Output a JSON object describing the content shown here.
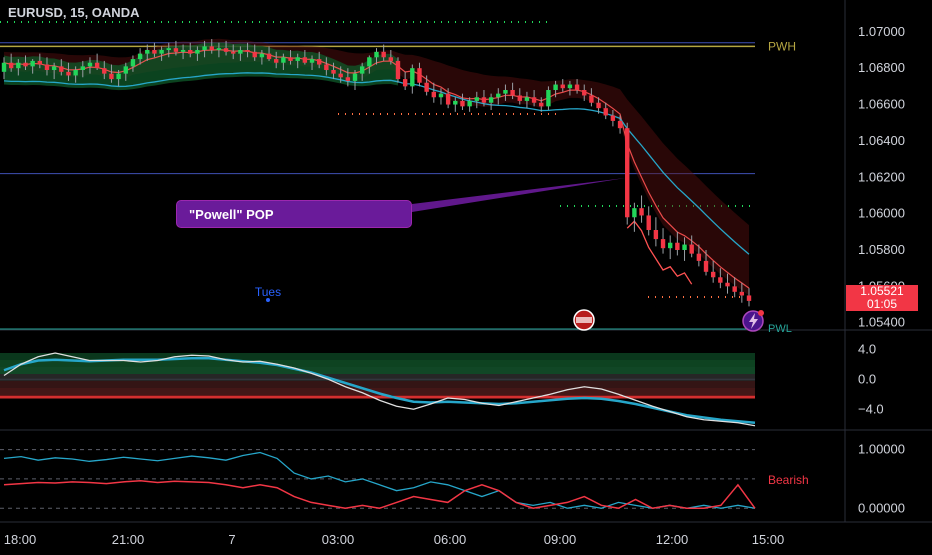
{
  "header": {
    "symbol_line": "EURUSD, 15, OANDA"
  },
  "price_tag": {
    "price": "1.05521",
    "countdown": "01:05"
  },
  "callout": {
    "text": "\"Powell\" POP"
  },
  "labels": {
    "pwh": "PWH",
    "pwl": "PWL",
    "tues": "Tues",
    "bearish": "Bearish"
  },
  "colors": {
    "bull": "#22d65a",
    "bear": "#f23645",
    "cyan": "#26a6c9",
    "olive": "#b5a642",
    "blue": "#3f51b5",
    "teal": "#26a69a",
    "purple": "#6a1b9a"
  },
  "chart_data": [
    {
      "type": "candlestick",
      "title": "EURUSD, 15, OANDA",
      "ylim": [
        1.0536,
        1.0712
      ],
      "y_ticks": [
        "1.07000",
        "1.06800",
        "1.06600",
        "1.06400",
        "1.06200",
        "1.06000",
        "1.05800",
        "1.05600",
        "1.05400"
      ],
      "x_ticks": [
        "18:00",
        "21:00",
        "7",
        "03:00",
        "06:00",
        "09:00",
        "12:00",
        "15:00"
      ],
      "levels": {
        "pwh": 1.0692,
        "pwl": 1.053,
        "line_top": 1.0694,
        "line_mid": 1.0622
      },
      "ohlc": [
        [
          1.0678,
          1.0686,
          1.0674,
          1.0683
        ],
        [
          1.0683,
          1.0688,
          1.0678,
          1.068
        ],
        [
          1.068,
          1.0685,
          1.0676,
          1.0683
        ],
        [
          1.0683,
          1.0687,
          1.0679,
          1.0681
        ],
        [
          1.0681,
          1.0685,
          1.0677,
          1.0684
        ],
        [
          1.0684,
          1.0688,
          1.068,
          1.0682
        ],
        [
          1.0682,
          1.0686,
          1.0676,
          1.0679
        ],
        [
          1.0679,
          1.0683,
          1.0674,
          1.0681
        ],
        [
          1.0681,
          1.0685,
          1.0676,
          1.0678
        ],
        [
          1.0678,
          1.0683,
          1.0673,
          1.0676
        ],
        [
          1.0676,
          1.0681,
          1.0672,
          1.0679
        ],
        [
          1.0679,
          1.0684,
          1.0675,
          1.0681
        ],
        [
          1.0681,
          1.0686,
          1.0677,
          1.0683
        ],
        [
          1.0683,
          1.0688,
          1.0679,
          1.068
        ],
        [
          1.068,
          1.0684,
          1.0674,
          1.0677
        ],
        [
          1.0677,
          1.0682,
          1.0672,
          1.0674
        ],
        [
          1.0674,
          1.0679,
          1.067,
          1.0677
        ],
        [
          1.0677,
          1.0683,
          1.0673,
          1.0681
        ],
        [
          1.0681,
          1.0687,
          1.0678,
          1.0685
        ],
        [
          1.0685,
          1.0691,
          1.0682,
          1.0688
        ],
        [
          1.0688,
          1.0693,
          1.0684,
          1.069
        ],
        [
          1.069,
          1.0694,
          1.0686,
          1.0688
        ],
        [
          1.0688,
          1.0692,
          1.0684,
          1.069
        ],
        [
          1.069,
          1.0694,
          1.0686,
          1.0691
        ],
        [
          1.0691,
          1.0695,
          1.0687,
          1.0689
        ],
        [
          1.0689,
          1.0693,
          1.0685,
          1.069
        ],
        [
          1.069,
          1.0694,
          1.0686,
          1.0688
        ],
        [
          1.0688,
          1.0692,
          1.0684,
          1.069
        ],
        [
          1.069,
          1.0695,
          1.0686,
          1.0692
        ],
        [
          1.0692,
          1.0696,
          1.0688,
          1.069
        ],
        [
          1.069,
          1.0694,
          1.0686,
          1.0691
        ],
        [
          1.0691,
          1.0695,
          1.0687,
          1.0689
        ],
        [
          1.0689,
          1.0693,
          1.0685,
          1.0688
        ],
        [
          1.0688,
          1.0692,
          1.0684,
          1.069
        ],
        [
          1.069,
          1.0694,
          1.0686,
          1.0689
        ],
        [
          1.0689,
          1.0693,
          1.0684,
          1.0686
        ],
        [
          1.0686,
          1.069,
          1.0682,
          1.0688
        ],
        [
          1.0688,
          1.0692,
          1.0684,
          1.0685
        ],
        [
          1.0685,
          1.0689,
          1.068,
          1.0683
        ],
        [
          1.0683,
          1.0688,
          1.0679,
          1.0686
        ],
        [
          1.0686,
          1.069,
          1.0682,
          1.0684
        ],
        [
          1.0684,
          1.0688,
          1.068,
          1.0686
        ],
        [
          1.0686,
          1.069,
          1.0682,
          1.0683
        ],
        [
          1.0683,
          1.0687,
          1.0679,
          1.0685
        ],
        [
          1.0685,
          1.0689,
          1.068,
          1.0682
        ],
        [
          1.0682,
          1.0686,
          1.0676,
          1.0679
        ],
        [
          1.0679,
          1.0683,
          1.0674,
          1.0677
        ],
        [
          1.0677,
          1.0681,
          1.0672,
          1.0675
        ],
        [
          1.0675,
          1.068,
          1.067,
          1.0673
        ],
        [
          1.0673,
          1.0679,
          1.0668,
          1.0677
        ],
        [
          1.0677,
          1.0683,
          1.0673,
          1.0681
        ],
        [
          1.0681,
          1.0687,
          1.0677,
          1.0686
        ],
        [
          1.0686,
          1.0691,
          1.0682,
          1.0689
        ],
        [
          1.0689,
          1.0693,
          1.0684,
          1.0686
        ],
        [
          1.0686,
          1.069,
          1.0682,
          1.0684
        ],
        [
          1.0684,
          1.0686,
          1.0672,
          1.0674
        ],
        [
          1.0674,
          1.0678,
          1.0668,
          1.067
        ],
        [
          1.067,
          1.0682,
          1.0666,
          1.068
        ],
        [
          1.068,
          1.0683,
          1.067,
          1.0672
        ],
        [
          1.0672,
          1.0676,
          1.0665,
          1.0667
        ],
        [
          1.0667,
          1.0672,
          1.0661,
          1.0664
        ],
        [
          1.0664,
          1.0669,
          1.066,
          1.0666
        ],
        [
          1.0666,
          1.0669,
          1.0658,
          1.066
        ],
        [
          1.066,
          1.0664,
          1.0656,
          1.0662
        ],
        [
          1.0662,
          1.0666,
          1.0657,
          1.0659
        ],
        [
          1.0659,
          1.0664,
          1.0656,
          1.0662
        ],
        [
          1.0662,
          1.0667,
          1.0658,
          1.0664
        ],
        [
          1.0664,
          1.0668,
          1.0659,
          1.0661
        ],
        [
          1.0661,
          1.0666,
          1.0657,
          1.0664
        ],
        [
          1.0664,
          1.0669,
          1.066,
          1.0666
        ],
        [
          1.0666,
          1.0671,
          1.0662,
          1.0668
        ],
        [
          1.0668,
          1.0672,
          1.0663,
          1.0665
        ],
        [
          1.0665,
          1.0669,
          1.066,
          1.0662
        ],
        [
          1.0662,
          1.0667,
          1.0658,
          1.0664
        ],
        [
          1.0664,
          1.0668,
          1.0659,
          1.0661
        ],
        [
          1.0661,
          1.0664,
          1.0656,
          1.0659
        ],
        [
          1.0659,
          1.067,
          1.0657,
          1.0668
        ],
        [
          1.0668,
          1.0673,
          1.0664,
          1.0671
        ],
        [
          1.0671,
          1.0674,
          1.0667,
          1.0669
        ],
        [
          1.0669,
          1.0673,
          1.0665,
          1.0671
        ],
        [
          1.0671,
          1.0674,
          1.0666,
          1.0668
        ],
        [
          1.0668,
          1.0671,
          1.0662,
          1.0665
        ],
        [
          1.0665,
          1.0669,
          1.0659,
          1.0661
        ],
        [
          1.0661,
          1.0664,
          1.0655,
          1.0658
        ],
        [
          1.0658,
          1.0661,
          1.0652,
          1.0654
        ],
        [
          1.0654,
          1.0657,
          1.0648,
          1.0651
        ],
        [
          1.0651,
          1.0654,
          1.0644,
          1.0647
        ],
        [
          1.0647,
          1.065,
          1.0594,
          1.0598
        ],
        [
          1.0598,
          1.0606,
          1.059,
          1.0603
        ],
        [
          1.0603,
          1.061,
          1.0595,
          1.0599
        ],
        [
          1.0599,
          1.0604,
          1.0588,
          1.0591
        ],
        [
          1.0591,
          1.0598,
          1.0582,
          1.0586
        ],
        [
          1.0586,
          1.0592,
          1.0578,
          1.0581
        ],
        [
          1.0581,
          1.0588,
          1.0575,
          1.0584
        ],
        [
          1.0584,
          1.059,
          1.0577,
          1.058
        ],
        [
          1.058,
          1.0587,
          1.0574,
          1.0583
        ],
        [
          1.0583,
          1.0588,
          1.0576,
          1.0578
        ],
        [
          1.0578,
          1.0583,
          1.0571,
          1.0574
        ],
        [
          1.0574,
          1.058,
          1.0566,
          1.0568
        ],
        [
          1.0568,
          1.0574,
          1.0562,
          1.0565
        ],
        [
          1.0565,
          1.057,
          1.0559,
          1.0562
        ],
        [
          1.0562,
          1.0567,
          1.0556,
          1.056
        ],
        [
          1.056,
          1.0565,
          1.0554,
          1.0557
        ],
        [
          1.0557,
          1.0562,
          1.0551,
          1.0555
        ],
        [
          1.0555,
          1.0559,
          1.0549,
          1.0552
        ]
      ]
    },
    {
      "type": "line",
      "title": "",
      "ylim": [
        -6.5,
        5.5
      ],
      "y_ticks": [
        "4.0",
        "0.0",
        "−4.0"
      ],
      "series": [
        {
          "name": "",
          "values": [
            0.5,
            2,
            3,
            3.5,
            3,
            2.5,
            2.5,
            2.5,
            2.3,
            2.5,
            3,
            3.2,
            3.1,
            2.6,
            2.3,
            2.4,
            2,
            1.5,
            0.8,
            0,
            -1,
            -1.8,
            -2.8,
            -3.6,
            -4,
            -3.3,
            -2.5,
            -2.7,
            -3.2,
            -3.5,
            -3,
            -2.5,
            -2,
            -1.4,
            -1,
            -1.3,
            -2,
            -2.8,
            -3.6,
            -4.3,
            -5,
            -5.4,
            -5.6,
            -5.8,
            -6.2
          ]
        },
        {
          "name": "",
          "values": [
            1.2,
            2,
            2.5,
            2.6,
            2.5,
            2.4,
            2.5,
            2.6,
            2.6,
            2.6,
            2.7,
            2.8,
            2.8,
            2.6,
            2.4,
            2.2,
            1.9,
            1.4,
            0.9,
            0.2,
            -0.5,
            -1.2,
            -1.9,
            -2.5,
            -3,
            -3.1,
            -3,
            -3.1,
            -3.2,
            -3.3,
            -3.2,
            -3,
            -2.8,
            -2.6,
            -2.5,
            -2.6,
            -2.9,
            -3.3,
            -3.8,
            -4.3,
            -4.8,
            -5.1,
            -5.4,
            -5.6,
            -5.8
          ]
        }
      ]
    },
    {
      "type": "line",
      "title": "",
      "ylim": [
        -0.2,
        1.3
      ],
      "y_ticks": [
        "1.00000",
        "0.00000"
      ],
      "series": [
        {
          "name": "",
          "values": [
            0.85,
            0.88,
            0.82,
            0.86,
            0.84,
            0.8,
            0.83,
            0.87,
            0.84,
            0.81,
            0.85,
            0.89,
            0.86,
            0.82,
            0.9,
            0.95,
            0.85,
            0.6,
            0.5,
            0.55,
            0.45,
            0.5,
            0.4,
            0.3,
            0.35,
            0.45,
            0.4,
            0.3,
            0.2,
            0.3,
            0.1,
            0.05,
            0.1,
            0.0,
            0.05,
            0.0,
            0.1,
            0.05,
            0.0,
            0.05,
            0.0,
            0.05,
            0.0,
            0.05,
            0.0
          ]
        },
        {
          "name": "",
          "values": [
            0.4,
            0.42,
            0.44,
            0.43,
            0.45,
            0.44,
            0.42,
            0.45,
            0.47,
            0.44,
            0.46,
            0.45,
            0.44,
            0.4,
            0.35,
            0.4,
            0.35,
            0.2,
            0.1,
            0.05,
            0.0,
            0.05,
            0.0,
            0.1,
            0.2,
            0.15,
            0.1,
            0.3,
            0.4,
            0.3,
            0.1,
            0.0,
            0.05,
            0.1,
            0.2,
            0.05,
            0.0,
            0.15,
            0.0,
            0.05,
            0.0,
            0.0,
            0.05,
            0.4,
            0.0
          ]
        }
      ]
    }
  ]
}
